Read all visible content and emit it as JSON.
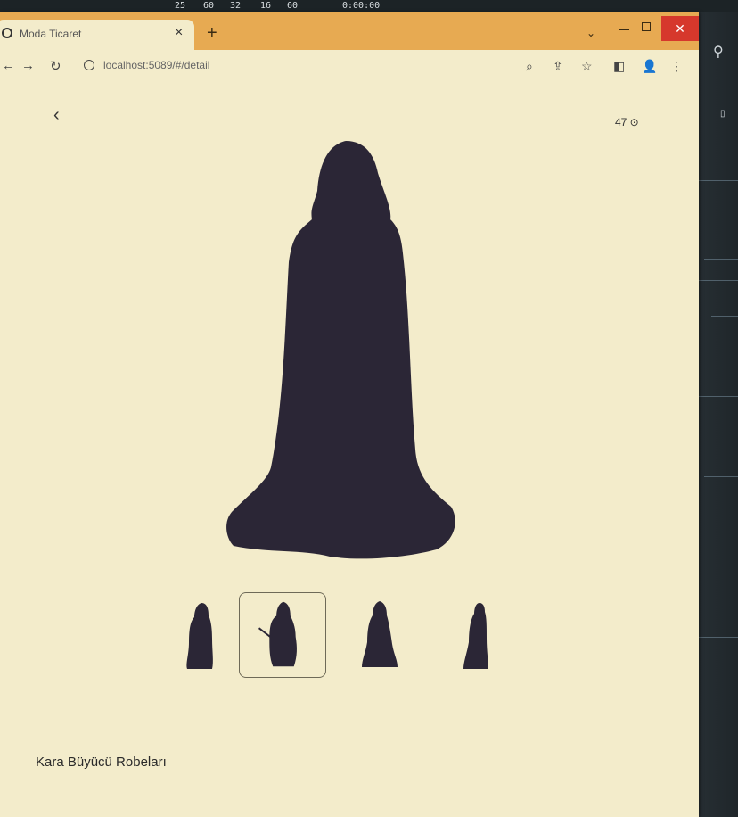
{
  "os_bar": {
    "items": [
      "25",
      "60",
      "32",
      "16",
      "60",
      "0:00:00"
    ]
  },
  "browser": {
    "tab_title": "Moda Ticaret",
    "tab_close": "×",
    "new_tab": "+",
    "url": "localhost:5089/#/detail",
    "close_glyph": "✕"
  },
  "page": {
    "back": "‹",
    "counter": "47 ⊙",
    "product_name": "Kara Büyücü Robeları",
    "thumbnails": [
      "thumb-1",
      "thumb-2",
      "thumb-3",
      "thumb-4"
    ],
    "selected_thumbnail": 2,
    "silhouette_color": "#2b2636",
    "background_color": "#f3eccb",
    "tab_bar_color": "#e7aa52"
  }
}
